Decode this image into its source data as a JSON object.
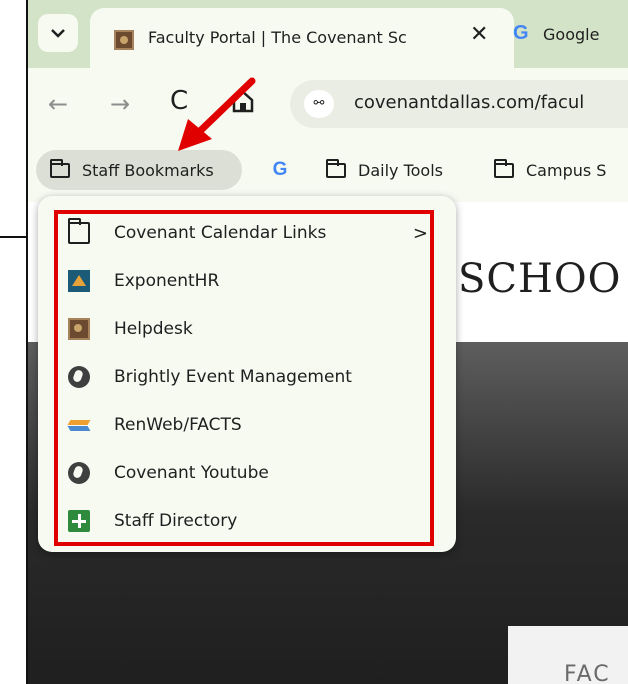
{
  "tabs": {
    "search_icon": "chevron-down-icon",
    "active": {
      "title": "Faculty Portal | The Covenant Sc",
      "close": "✕"
    },
    "second": {
      "logo": "G",
      "title": "Google"
    }
  },
  "toolbar": {
    "back": "←",
    "forward": "→",
    "reload": "C",
    "url": "covenantdallas.com/facul",
    "tune_icon": "site-info-icon"
  },
  "bookmarks_bar": {
    "staff": "Staff Bookmarks",
    "google": "G",
    "daily": "Daily Tools",
    "campus": "Campus S"
  },
  "page": {
    "heading": "SCHOO",
    "hero_text": "FAC"
  },
  "menu": {
    "items": [
      {
        "label": "Covenant Calendar Links",
        "icon": "folder-icon",
        "submenu": ">"
      },
      {
        "label": "ExponentHR",
        "icon": "exponenthr-icon"
      },
      {
        "label": "Helpdesk",
        "icon": "helpdesk-icon"
      },
      {
        "label": "Brightly Event Management",
        "icon": "globe-icon"
      },
      {
        "label": "RenWeb/FACTS",
        "icon": "renweb-icon"
      },
      {
        "label": "Covenant Youtube",
        "icon": "globe-icon"
      },
      {
        "label": "Staff Directory",
        "icon": "directory-icon"
      }
    ]
  },
  "colors": {
    "highlight": "#e00000",
    "arrow": "#e00000",
    "tab_strip": "#d3e3c8"
  }
}
